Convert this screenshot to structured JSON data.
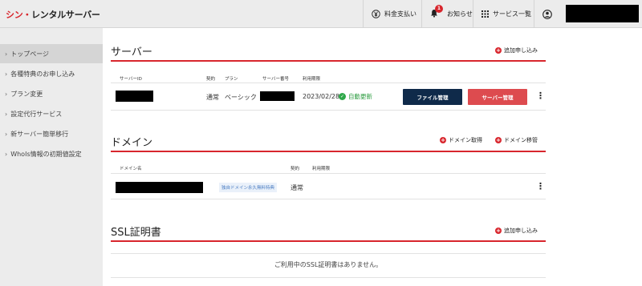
{
  "header": {
    "logo_red": "シン・",
    "logo_dark": "レンタルサーバー",
    "payment_label": "料金支払い",
    "news_label": "お知らせ",
    "news_badge": "1",
    "service_list_label": "サービス一覧"
  },
  "sidebar": {
    "items": [
      {
        "label": "トップページ"
      },
      {
        "label": "各種特典のお申し込み"
      },
      {
        "label": "プラン変更"
      },
      {
        "label": "設定代行サービス"
      },
      {
        "label": "新サーバー簡単移行"
      },
      {
        "label": "WhoIs情報の初期値設定"
      }
    ]
  },
  "server": {
    "title": "サーバー",
    "add_label": "追加申し込み",
    "headers": [
      "サーバーID",
      "契約",
      "プラン",
      "サーバー番号",
      "利用期限"
    ],
    "row": {
      "contract": "通常",
      "plan": "ベーシック",
      "expiry": "2023/02/28",
      "auto_renew": "自動更新",
      "file_button": "ファイル管理",
      "server_button": "サーバー管理"
    }
  },
  "domain": {
    "title": "ドメイン",
    "acquire_label": "ドメイン取得",
    "transfer_label": "ドメイン移管",
    "headers": [
      "ドメイン名",
      "契約",
      "利用期限"
    ],
    "row": {
      "tag": "独自ドメイン永久無料特典",
      "contract": "通常"
    }
  },
  "ssl": {
    "title": "SSL証明書",
    "add_label": "追加申し込み",
    "empty_message": "ご利用中のSSL証明書はありません。"
  },
  "colors": {
    "brand_red": "#d8262d",
    "navy_button": "#0f2a4a",
    "red_button": "#dd4b4f",
    "renew_green": "#2a9b3e"
  }
}
